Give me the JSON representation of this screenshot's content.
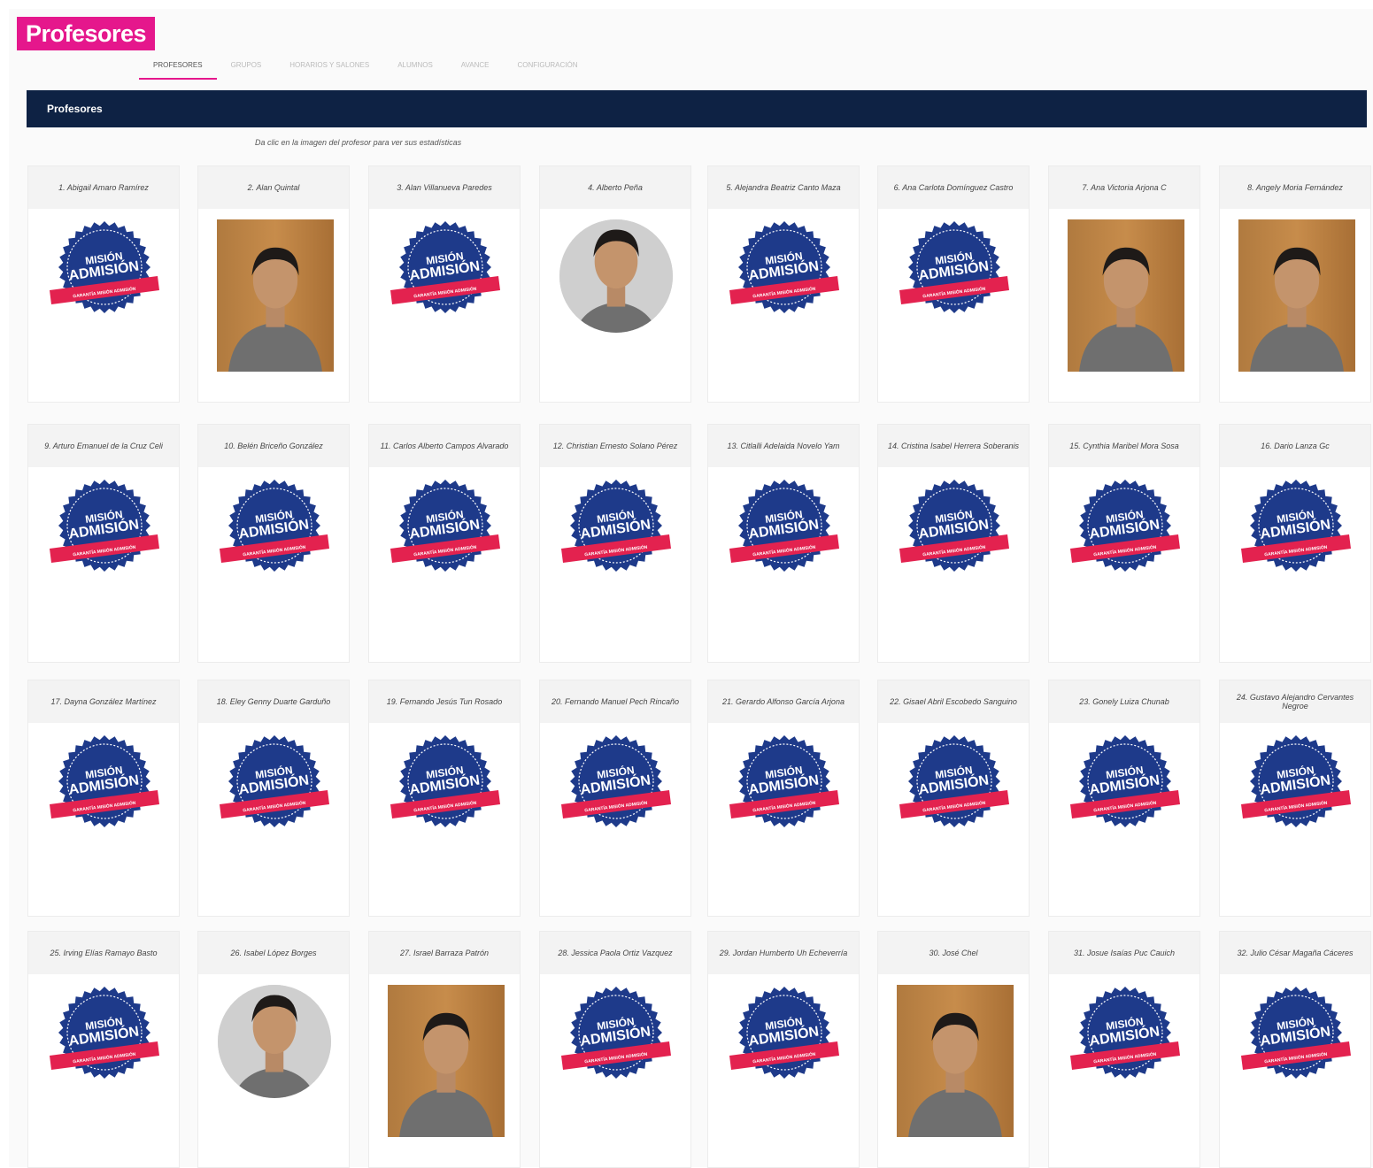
{
  "page": {
    "title": "Profesores",
    "tabs": [
      {
        "label": "PROFESORES",
        "active": true
      },
      {
        "label": "GRUPOS",
        "active": false
      },
      {
        "label": "HORARIOS Y SALONES",
        "active": false
      },
      {
        "label": "ALUMNOS",
        "active": false
      },
      {
        "label": "AVANCE",
        "active": false
      },
      {
        "label": "CONFIGURACIÓN",
        "active": false
      }
    ],
    "banner_title": "Profesores",
    "hint": "Da clic en la imagen del profesor para ver sus estadísticas"
  },
  "logo": {
    "line1": "MISIÓN",
    "line2": "ADMISIÓN",
    "ribbon": "GARANTÍA MISIÓN ADMISIÓN",
    "badge_color": "#1e3a8a",
    "ribbon_color": "#e3224f"
  },
  "teachers": [
    {
      "name": "1. Abigail Amaro Ramírez",
      "photo": "logo"
    },
    {
      "name": "2. Alan Quintal",
      "photo": "photo"
    },
    {
      "name": "3. Alan Villanueva Paredes",
      "photo": "logo"
    },
    {
      "name": "4. Alberto Peña",
      "photo": "circle"
    },
    {
      "name": "5. Alejandra Beatriz Canto Maza",
      "photo": "logo"
    },
    {
      "name": "6. Ana Carlota Domínguez Castro",
      "photo": "logo"
    },
    {
      "name": "7. Ana Victoria Arjona C",
      "photo": "photo"
    },
    {
      "name": "8. Angely Moria Fernández",
      "photo": "photo"
    },
    {
      "name": "9. Arturo Emanuel de la Cruz Celi",
      "photo": "logo"
    },
    {
      "name": "10. Belén Briceño González",
      "photo": "logo"
    },
    {
      "name": "11. Carlos Alberto Campos Alvarado",
      "photo": "logo"
    },
    {
      "name": "12. Christian Ernesto Solano Pérez",
      "photo": "logo"
    },
    {
      "name": "13. Citlalli Adelaida Novelo Yam",
      "photo": "logo"
    },
    {
      "name": "14. Cristina Isabel Herrera Soberanis",
      "photo": "logo"
    },
    {
      "name": "15. Cynthia Maribel Mora Sosa",
      "photo": "logo"
    },
    {
      "name": "16. Dario Lanza Gc",
      "photo": "logo"
    },
    {
      "name": "17. Dayna González Martínez",
      "photo": "logo"
    },
    {
      "name": "18. Eley Genny Duarte Garduño",
      "photo": "logo"
    },
    {
      "name": "19. Fernando Jesús Tun Rosado",
      "photo": "logo"
    },
    {
      "name": "20. Fernando Manuel Pech Rincaño",
      "photo": "logo"
    },
    {
      "name": "21. Gerardo Alfonso García Arjona",
      "photo": "logo"
    },
    {
      "name": "22. Gisael Abril Escobedo Sanguino",
      "photo": "logo"
    },
    {
      "name": "23. Gonely Luiza Chunab",
      "photo": "logo"
    },
    {
      "name": "24. Gustavo Alejandro Cervantes Negroe",
      "photo": "logo"
    },
    {
      "name": "25. Irving Elías Ramayo Basto",
      "photo": "logo"
    },
    {
      "name": "26. Isabel López Borges",
      "photo": "circle"
    },
    {
      "name": "27. Israel Barraza Patrón",
      "photo": "photo"
    },
    {
      "name": "28. Jessica Paola Ortiz Vazquez",
      "photo": "logo"
    },
    {
      "name": "29. Jordan Humberto Uh Echeverría",
      "photo": "logo"
    },
    {
      "name": "30. José Chel",
      "photo": "photo"
    },
    {
      "name": "31. Josue Isaías Puc Cauich",
      "photo": "logo"
    },
    {
      "name": "32. Julio César Magaña Cáceres",
      "photo": "logo"
    }
  ]
}
